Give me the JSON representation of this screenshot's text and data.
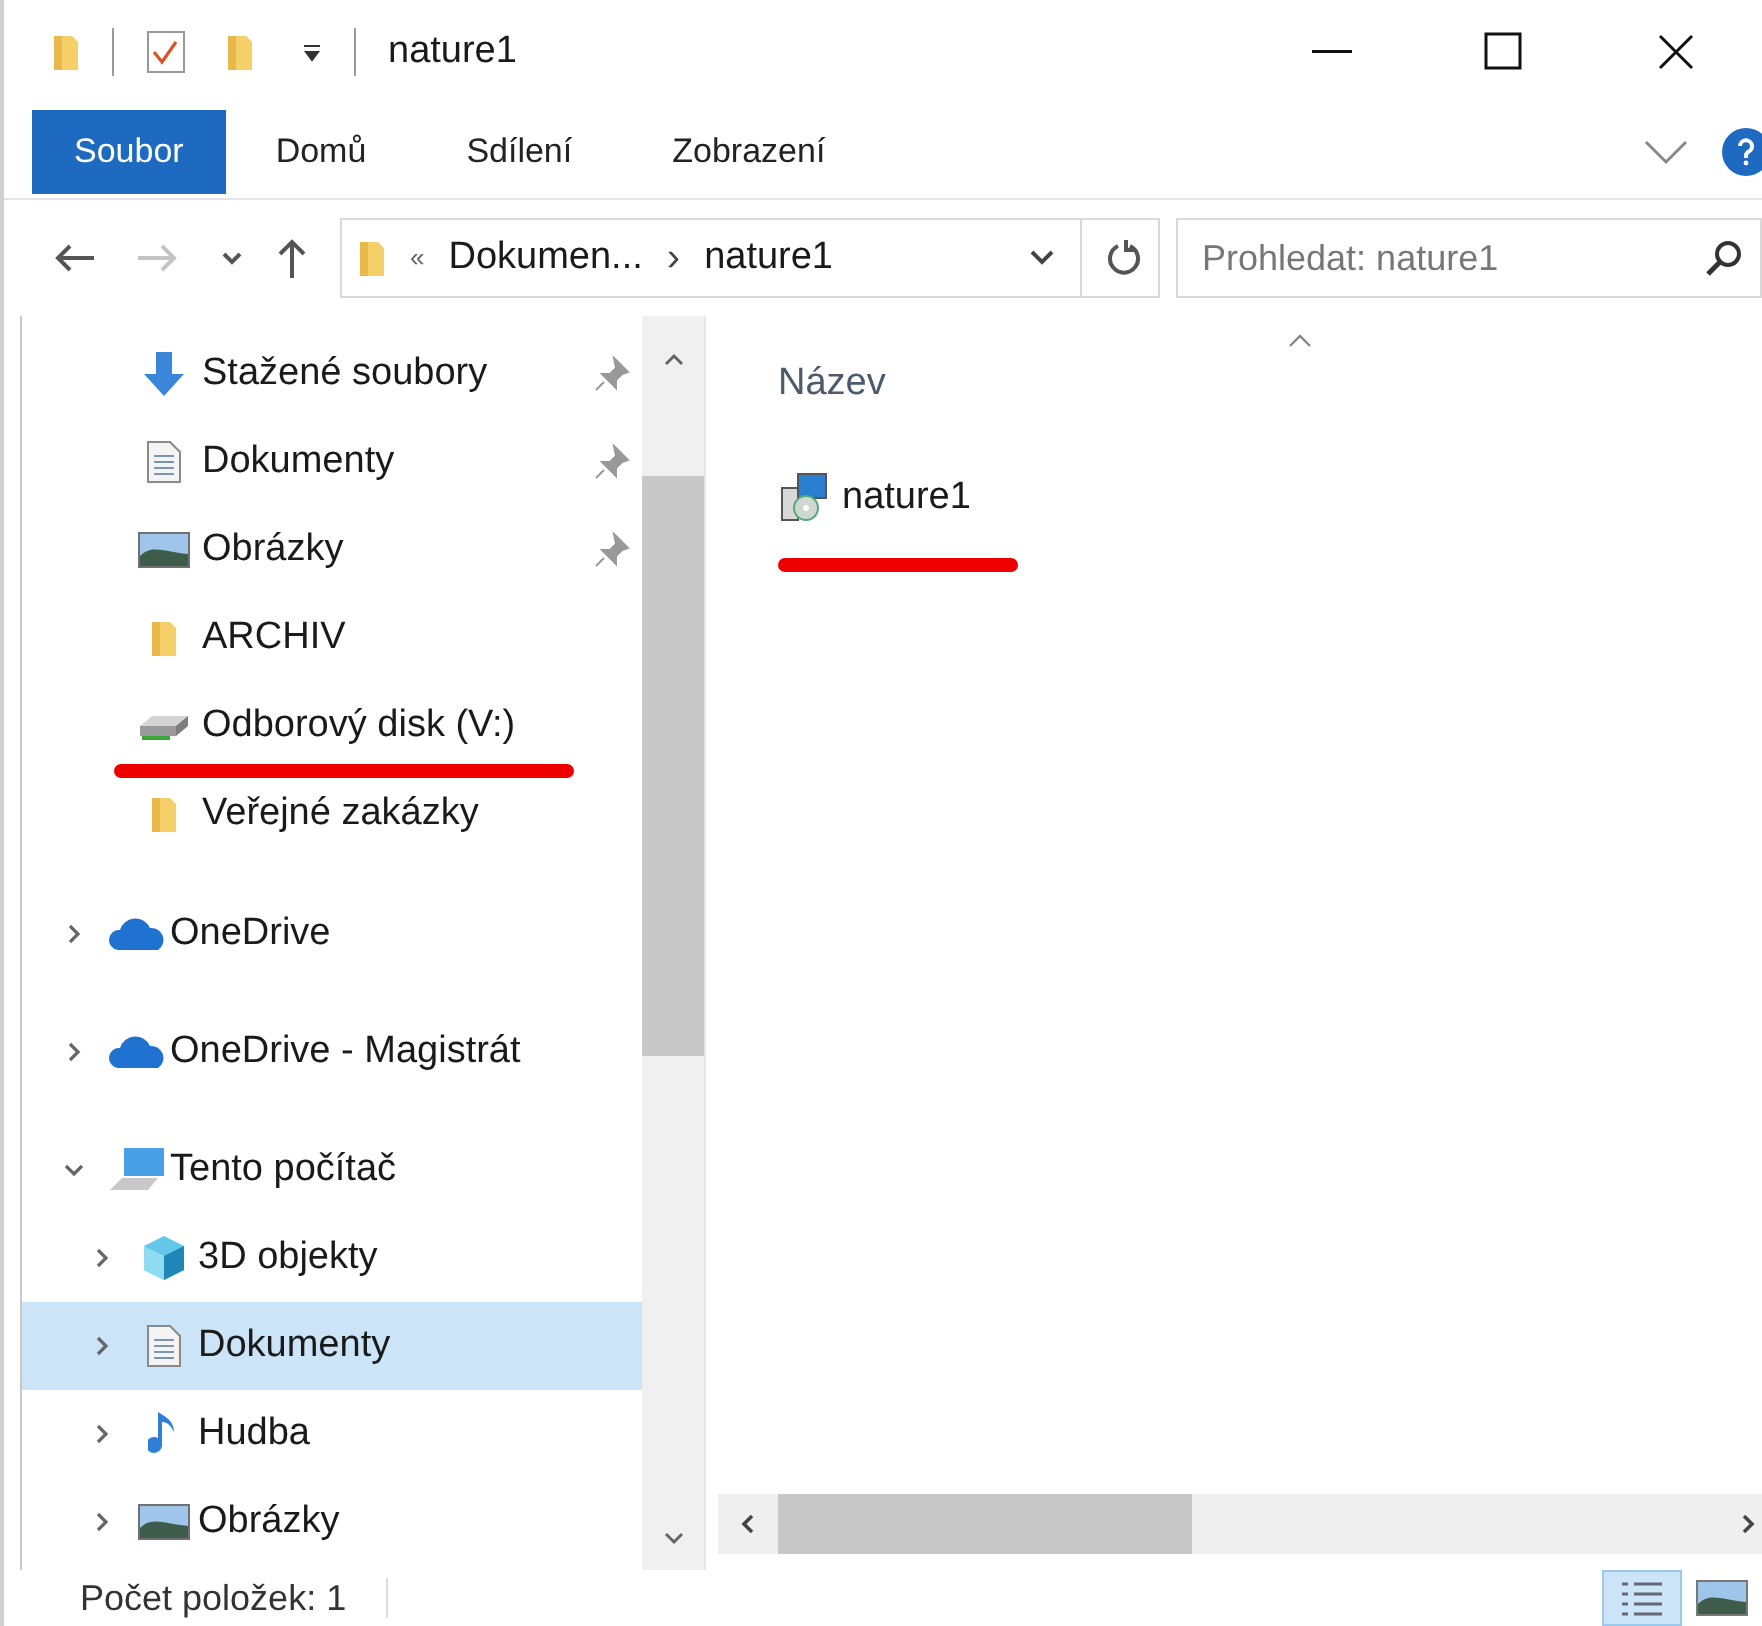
{
  "window": {
    "title": "nature1"
  },
  "ribbon_tabs": [
    {
      "label": "Soubor",
      "selected": true
    },
    {
      "label": "Domů",
      "selected": false
    },
    {
      "label": "Sdílení",
      "selected": false
    },
    {
      "label": "Zobrazení",
      "selected": false
    }
  ],
  "address_bar": {
    "overflow": "«",
    "path": [
      {
        "label": "Dokumen..."
      },
      {
        "label": "nature1"
      }
    ],
    "separator": "›"
  },
  "search": {
    "placeholder": "Prohledat: nature1"
  },
  "quick_access": [
    {
      "label": "Stažené soubory",
      "kind": "download",
      "pinned": true,
      "marked": false
    },
    {
      "label": "Dokumenty",
      "kind": "document",
      "pinned": true,
      "marked": false
    },
    {
      "label": "Obrázky",
      "kind": "picture",
      "pinned": true,
      "marked": false
    },
    {
      "label": "ARCHIV",
      "kind": "folder",
      "pinned": false,
      "marked": false
    },
    {
      "label": "Odborový disk (V:)",
      "kind": "drive",
      "pinned": false,
      "marked": true
    },
    {
      "label": "Veřejné zakázky",
      "kind": "folder",
      "pinned": false,
      "marked": false
    }
  ],
  "tree": [
    {
      "label": "OneDrive",
      "kind": "cloud",
      "expanded": false
    },
    {
      "label": "OneDrive - Magistrát",
      "kind": "cloud",
      "expanded": false
    },
    {
      "label": "Tento počítač",
      "kind": "computer",
      "expanded": true,
      "children": [
        {
          "label": "3D objekty",
          "kind": "cube",
          "selected": false
        },
        {
          "label": "Dokumenty",
          "kind": "document",
          "selected": true
        },
        {
          "label": "Hudba",
          "kind": "music",
          "selected": false
        },
        {
          "label": "Obrázky",
          "kind": "picture",
          "selected": false
        }
      ]
    }
  ],
  "file_list": {
    "column": "Název",
    "files": [
      {
        "name": "nature1",
        "kind": "installer",
        "marked": true
      }
    ]
  },
  "status_bar": {
    "text": "Počet položek: 1",
    "views": [
      {
        "kind": "details",
        "selected": true
      },
      {
        "kind": "thumbnails",
        "selected": false
      }
    ]
  }
}
